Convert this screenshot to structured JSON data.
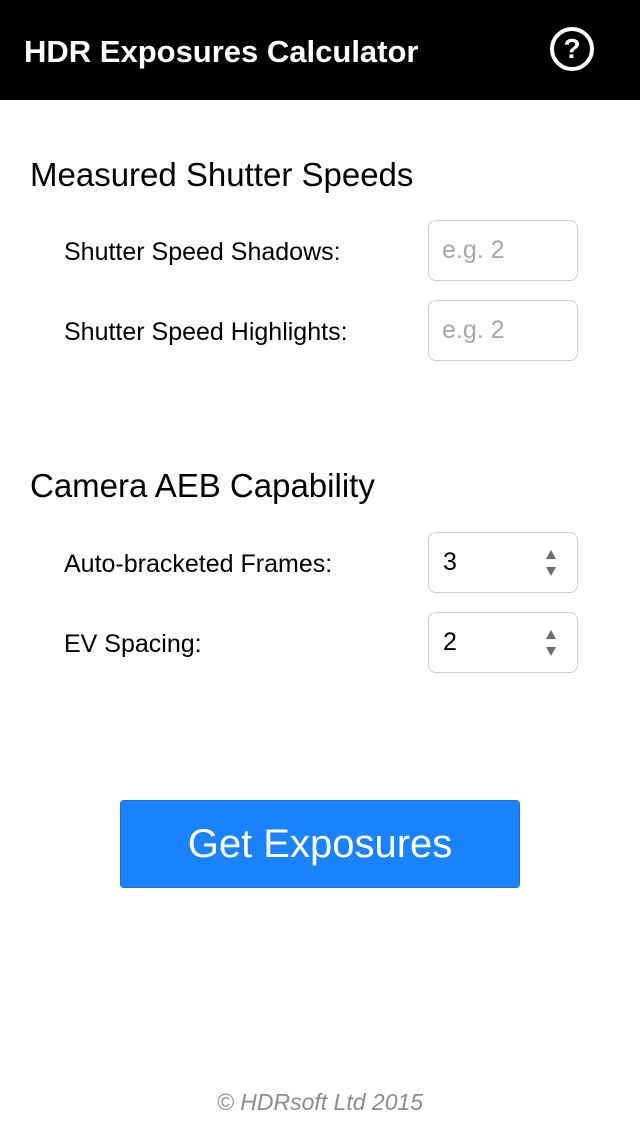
{
  "header": {
    "title": "HDR Exposures Calculator",
    "help_glyph": "?"
  },
  "measured": {
    "title": "Measured Shutter Speeds",
    "shadows_label": "Shutter Speed Shadows:",
    "shadows_placeholder": "e.g. 2",
    "shadows_value": "",
    "highlights_label": "Shutter Speed Highlights:",
    "highlights_placeholder": "e.g. 2",
    "highlights_value": ""
  },
  "aeb": {
    "title": "Camera AEB Capability",
    "frames_label": "Auto-bracketed Frames:",
    "frames_value": "3",
    "spacing_label": "EV Spacing:",
    "spacing_value": "2"
  },
  "action": {
    "button_label": "Get Exposures"
  },
  "footer": {
    "copyright": "© HDRsoft Ltd 2015"
  },
  "colors": {
    "header_bg": "#000000",
    "accent": "#1a82fb",
    "placeholder": "#a8a8a8",
    "footer_text": "#8c8c8c"
  },
  "icons": {
    "help": "help-circle-icon",
    "spinner": "spinner-arrows-icon"
  }
}
